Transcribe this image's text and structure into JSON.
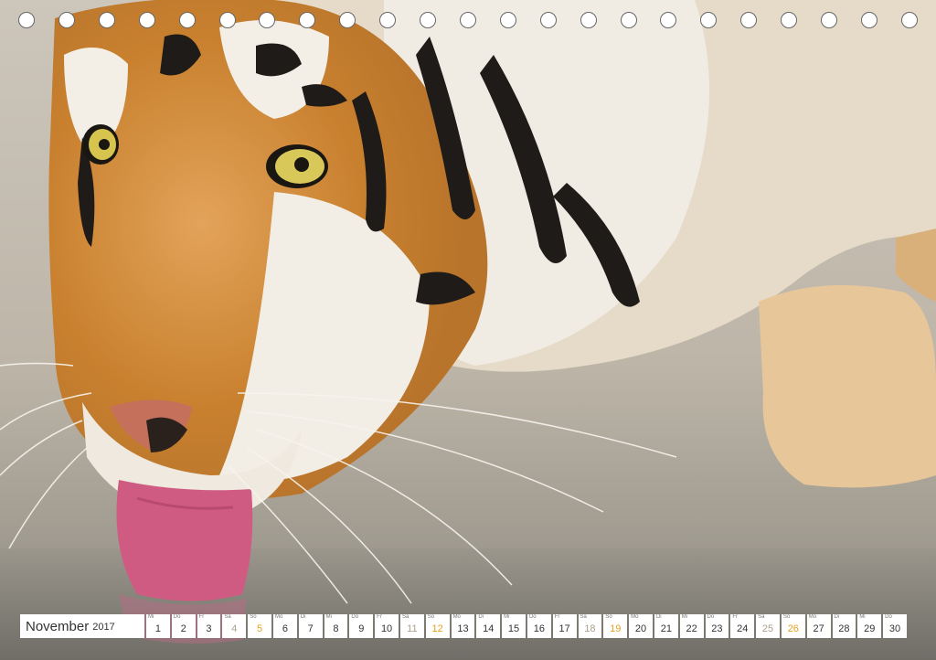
{
  "page": {
    "title": "Tiger calendar page – November 2017"
  },
  "photo": {
    "subject": "tiger drinking water"
  },
  "calendar": {
    "month": "November",
    "year": "2017",
    "colors": {
      "weekday": "#333333",
      "saturday": "#aaa08c",
      "sunday": "#e8a020"
    },
    "days": [
      {
        "wd": "Mi",
        "d": "1",
        "t": ""
      },
      {
        "wd": "Do",
        "d": "2",
        "t": ""
      },
      {
        "wd": "Fr",
        "d": "3",
        "t": ""
      },
      {
        "wd": "Sa",
        "d": "4",
        "t": "sat"
      },
      {
        "wd": "So",
        "d": "5",
        "t": "sun"
      },
      {
        "wd": "Mo",
        "d": "6",
        "t": ""
      },
      {
        "wd": "Di",
        "d": "7",
        "t": ""
      },
      {
        "wd": "Mi",
        "d": "8",
        "t": ""
      },
      {
        "wd": "Do",
        "d": "9",
        "t": ""
      },
      {
        "wd": "Fr",
        "d": "10",
        "t": ""
      },
      {
        "wd": "Sa",
        "d": "11",
        "t": "sat"
      },
      {
        "wd": "So",
        "d": "12",
        "t": "sun"
      },
      {
        "wd": "Mo",
        "d": "13",
        "t": ""
      },
      {
        "wd": "Di",
        "d": "14",
        "t": ""
      },
      {
        "wd": "Mi",
        "d": "15",
        "t": ""
      },
      {
        "wd": "Do",
        "d": "16",
        "t": ""
      },
      {
        "wd": "Fr",
        "d": "17",
        "t": ""
      },
      {
        "wd": "Sa",
        "d": "18",
        "t": "sat"
      },
      {
        "wd": "So",
        "d": "19",
        "t": "sun"
      },
      {
        "wd": "Mo",
        "d": "20",
        "t": ""
      },
      {
        "wd": "Di",
        "d": "21",
        "t": ""
      },
      {
        "wd": "Mi",
        "d": "22",
        "t": ""
      },
      {
        "wd": "Do",
        "d": "23",
        "t": ""
      },
      {
        "wd": "Fr",
        "d": "24",
        "t": ""
      },
      {
        "wd": "Sa",
        "d": "25",
        "t": "sat"
      },
      {
        "wd": "So",
        "d": "26",
        "t": "sun"
      },
      {
        "wd": "Mo",
        "d": "27",
        "t": ""
      },
      {
        "wd": "Di",
        "d": "28",
        "t": ""
      },
      {
        "wd": "Mi",
        "d": "29",
        "t": ""
      },
      {
        "wd": "Do",
        "d": "30",
        "t": ""
      }
    ]
  }
}
